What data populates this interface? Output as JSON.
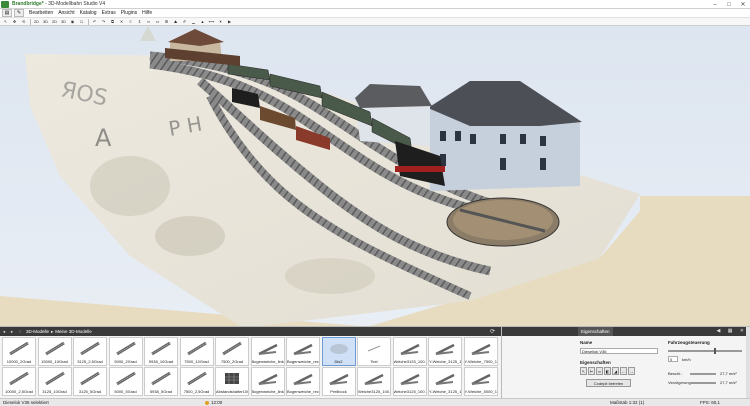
{
  "window": {
    "title_brand": "Brandbridge*",
    "title_rest": "- 3D-Modellbahn Studio V4",
    "controls": [
      "–",
      "□",
      "✕"
    ]
  },
  "menu": {
    "items": [
      "Bearbeiten",
      "Ansicht",
      "Katalog",
      "Extras",
      "Plugins",
      "Hilfe"
    ]
  },
  "toolbar": {
    "labels": [
      "2D",
      "3D",
      "2D",
      "3D"
    ]
  },
  "model_panel": {
    "crumbs": [
      "3D-Modelle",
      "Meine 3D-Modelle"
    ],
    "tiles": [
      {
        "caption": "10000_2Grad",
        "kind": "track"
      },
      {
        "caption": "15000_10Grad",
        "kind": "track"
      },
      {
        "caption": "3125_2,5Grad",
        "kind": "track"
      },
      {
        "caption": "5000_2Grad",
        "kind": "track"
      },
      {
        "caption": "5938_10Grad",
        "kind": "track"
      },
      {
        "caption": "7500_10Grad",
        "kind": "track"
      },
      {
        "caption": "7500_2Grad",
        "kind": "track"
      },
      {
        "caption": "Bogenweiche_links",
        "kind": "switch"
      },
      {
        "caption": "Bogenweiche_rec...",
        "kind": "switch"
      },
      {
        "caption": "Dis2",
        "kind": "shape"
      },
      {
        "caption": "Text",
        "kind": "text"
      },
      {
        "caption": "Weiche3125_100...",
        "kind": "switch"
      },
      {
        "caption": "Y-Weiche_3125_1...",
        "kind": "switch"
      },
      {
        "caption": "Y-Weiche_7500_1...",
        "kind": "switch"
      },
      {
        "caption": "10000_2,5Grad",
        "kind": "track"
      },
      {
        "caption": "3125_10Grad",
        "kind": "track"
      },
      {
        "caption": "3125_5Grad",
        "kind": "track"
      },
      {
        "caption": "5000_5Grad",
        "kind": "track"
      },
      {
        "caption": "5938_5Grad",
        "kind": "track"
      },
      {
        "caption": "7500_2,5Grad",
        "kind": "track"
      },
      {
        "caption": "Abstandshalter100",
        "kind": "grid"
      },
      {
        "caption": "Bogenweiche_links",
        "kind": "switch"
      },
      {
        "caption": "Bogenweiche_rec...",
        "kind": "switch"
      },
      {
        "caption": "Prellbock",
        "kind": "switch"
      },
      {
        "caption": "Weiche3125_100...",
        "kind": "switch"
      },
      {
        "caption": "Weiche3125_100...",
        "kind": "switch"
      },
      {
        "caption": "Y-Weiche_3125_1...",
        "kind": "switch"
      },
      {
        "caption": "Y-Weiche_5000_1...",
        "kind": "switch"
      }
    ],
    "selected_index": 9
  },
  "props_panel": {
    "tab_label": "Eigenschaften",
    "name_label": "Name",
    "name_value": "Diesellok V36",
    "section_label": "Eigenschaften",
    "codepit_button": "Codepit betreten",
    "drive_label": "Fahrzeugsteuerung",
    "speed_value": "0",
    "speed_unit": "km/h",
    "accel_label": "Beschl.:",
    "accel_value": "27,7 m/s²",
    "decel_label": "Verzögerung:",
    "decel_value": "27,7 m/s²",
    "speed_level": 0.62
  },
  "status": {
    "selection": "Dieselok V36 selektiert",
    "time": "12:00",
    "scale": "Maßstab 1:32 (1)",
    "fps": "FPS: 60,1"
  },
  "colors": {
    "title_brand": "#2d7a2d",
    "panel_header": "#3a3a3a",
    "selected_tile": "#cfe0f7"
  }
}
